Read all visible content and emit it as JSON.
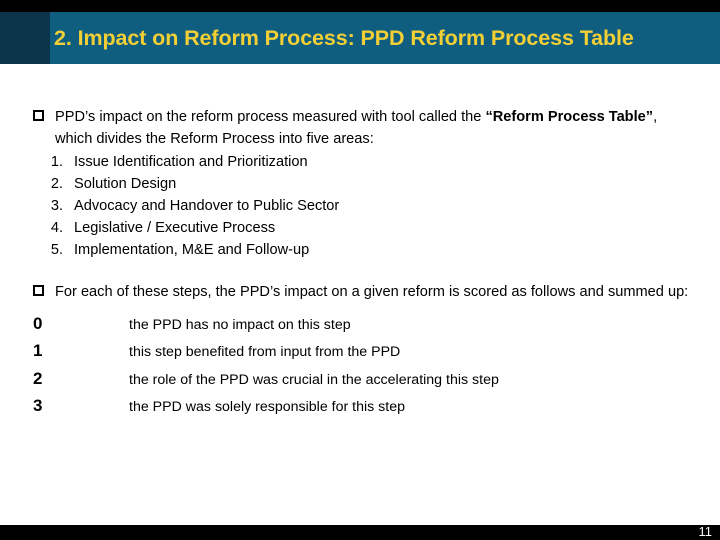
{
  "slide": {
    "page_number": "11",
    "colors": {
      "header_band": "#0f5e80",
      "header_dark_band": "#0b3349",
      "header_title": "#f2cf35",
      "top_bar": "#000000",
      "footer_bar": "#000000",
      "body_text": "#000000",
      "background": "#ffffff"
    }
  },
  "header": {
    "title": "2.  Impact on Reform Process: PPD Reform Process Table"
  },
  "content": {
    "bullet_glyph": "hollow-square-bullet",
    "block_one": {
      "intro_part1": "PPD’s impact on the reform process measured with tool called the ",
      "intro_quoted": "“Reform Process Table”",
      "intro_part2": ", which divides the Reform Process into five areas:",
      "areas": [
        {
          "number": "1.",
          "label": "Issue Identification and Prioritization"
        },
        {
          "number": "2.",
          "label": "Solution Design"
        },
        {
          "number": "3.",
          "label": "Advocacy and Handover to Public Sector"
        },
        {
          "number": "4.",
          "label": "Legislative / Executive Process"
        },
        {
          "number": "5.",
          "label": "Implementation, M&E and Follow-up"
        }
      ]
    },
    "block_two": {
      "intro": "For each of these steps, the PPD’s impact on a given reform is scored as follows and summed up:",
      "scores": [
        {
          "score": "0",
          "description": "the PPD has no impact on this step"
        },
        {
          "score": "1",
          "description": "this step benefited from input from the PPD"
        },
        {
          "score": "2",
          "description": "the role of the PPD was crucial in the accelerating this step"
        },
        {
          "score": "3",
          "description": "the PPD was solely responsible for this step"
        }
      ]
    }
  }
}
